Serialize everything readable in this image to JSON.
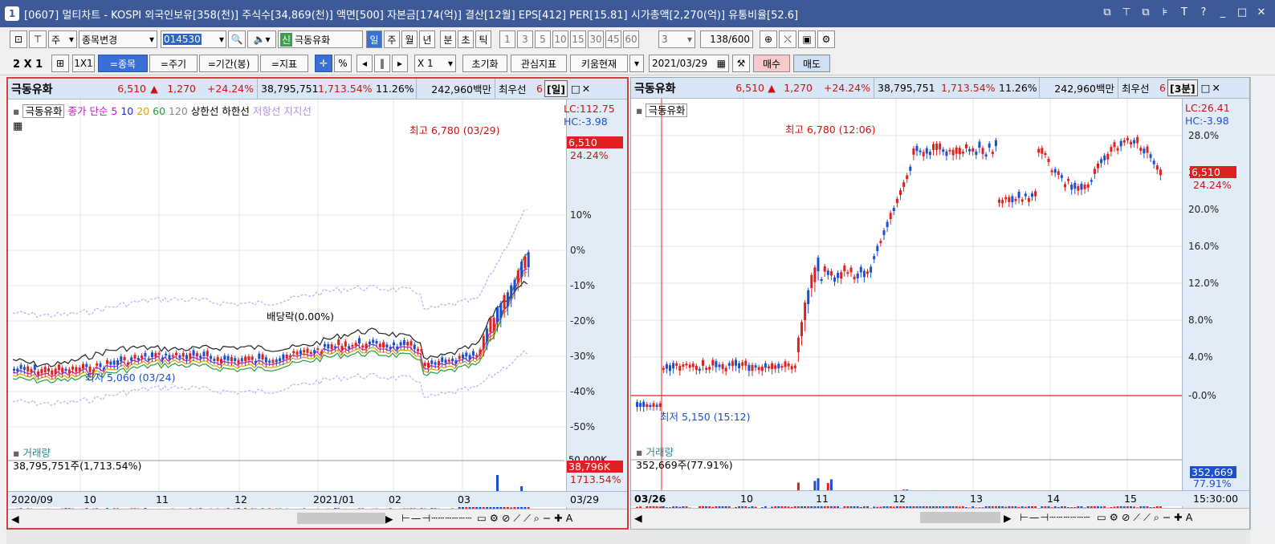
{
  "window": {
    "title_num": "1",
    "title": "[0607] 멀티차트 - KOSPI 외국인보유[358(천)] 주식수[34,869(천)] 액면[500] 자본금[174(억)] 결산[12월] EPS[412] PER[15.81] 시가총액[2,270(억)] 유통비율[52.6]",
    "buttons": [
      "⧉",
      "⊤",
      "⧉",
      "⊧",
      "T",
      "?",
      "_",
      "□",
      "✕"
    ]
  },
  "toolbar1": {
    "period_select": "주",
    "mode_select": "종목변경",
    "code": "014530",
    "stock_badge": "신",
    "stock_name": "극동유화",
    "period_tabs": [
      "일",
      "주",
      "월",
      "년",
      "분",
      "초",
      "틱"
    ],
    "active_period": "일",
    "numbers": [
      "1",
      "3",
      "5",
      "10",
      "15",
      "30",
      "45",
      "60"
    ],
    "count_select": "3",
    "page": "138",
    "page_total": "/600"
  },
  "toolbar2": {
    "layout": "2 X 1",
    "one_by_one": "1X1",
    "buttons": [
      "=종목",
      "=주기",
      "=기간(봉)",
      "=지표"
    ],
    "pct": "%",
    "x_select": "X 1",
    "reset": "초기화",
    "interest": "관심지표",
    "kiwoom": "키움현재",
    "date": "2021/03/29",
    "buy": "매수",
    "sell": "매도"
  },
  "left_panel": {
    "header": {
      "name": "극동유화",
      "price": "6,510",
      "change": "1,270",
      "rate": "+24.24%",
      "volume": "38,795,751",
      "vol_rate": "1,713.54%",
      "turnover": "11.26%",
      "amount": "242,960백만",
      "best": "최우선",
      "tail": "6",
      "period": "[일]"
    },
    "legend": {
      "name": "극동유화",
      "ma_label": "종가 단순 5",
      "ma10": "10",
      "ma20": "20",
      "ma60": "60",
      "ma120": "120",
      "upper": "상한선",
      "lower": "하한선",
      "resist": "저항선",
      "support": "지지선"
    },
    "lc": "LC:112.75",
    "hc": "HC:-3.98",
    "high_note": "최고 6,780 (03/29)",
    "low_note": "최저 5,060 (03/24)",
    "div_note": "배당락(0.00%)",
    "price_box": "6,510",
    "price_pct": "24.24%",
    "axis": [
      "10%",
      "0%",
      "-10%",
      "-20%",
      "-30%",
      "-40%",
      "-50%"
    ],
    "vol_label": "거래량",
    "vol_value": "38,795,751주(1,713.54%)",
    "vol_axis": "50,000K",
    "vol_box": "38,796K",
    "vol_pct": "1713.54%",
    "dates": [
      "2020/09",
      "10",
      "11",
      "12",
      "2021/01",
      "02",
      "03"
    ],
    "date_right": "03/29"
  },
  "right_panel": {
    "header": {
      "name": "극동유화",
      "price": "6,510",
      "change": "1,270",
      "rate": "+24.24%",
      "volume": "38,795,751",
      "vol_rate": "1,713.54%",
      "turnover": "11.26%",
      "amount": "242,960백만",
      "best": "최우선",
      "tail": "6",
      "period": "[3분]"
    },
    "legend": {
      "name": "극동유화"
    },
    "lc": "LC:26.41",
    "hc": "HC:-3.98",
    "high_note": "최고 6,780 (12:06)",
    "low_note": "최저 5,150 (15:12)",
    "price_box": "6,510",
    "price_pct": "24.24%",
    "axis": [
      "28.0%",
      "24.0%",
      "20.0%",
      "16.0%",
      "12.0%",
      "8.0%",
      "4.0%",
      "-0.0%"
    ],
    "vol_label": "거래량",
    "vol_value": "352,669주(77.91%)",
    "vol_box": "352,669",
    "vol_pct": "77.91%",
    "dates": [
      "03/26",
      "10",
      "11",
      "12",
      "13",
      "14",
      "15"
    ],
    "date_right": "15:30:00"
  },
  "colors": {
    "up": "#e02020",
    "down": "#1a4fd0",
    "title": "#3d5a98",
    "header": "#d8e6f5"
  }
}
